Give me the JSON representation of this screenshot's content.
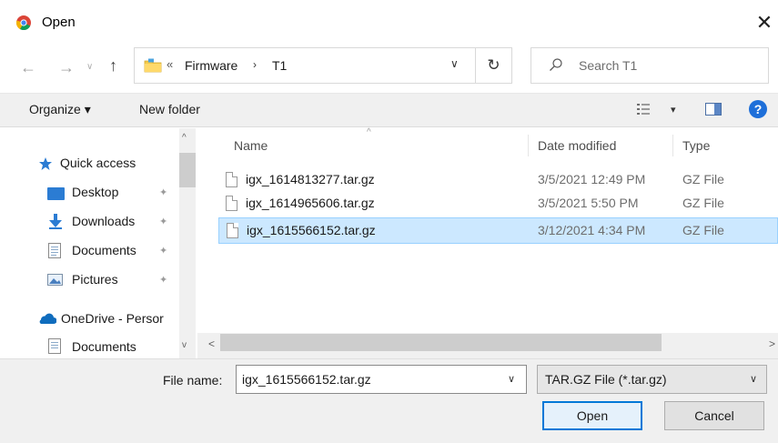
{
  "window": {
    "title": "Open",
    "close_glyph": "✕"
  },
  "nav": {
    "back_glyph": "←",
    "forward_glyph": "→",
    "recent_glyph": "∨",
    "up_glyph": "↑",
    "breadcrumb_overflow": "«",
    "breadcrumbs": [
      "Firmware",
      "T1"
    ],
    "breadcrumb_sep": "›",
    "address_dropdown": "∨",
    "refresh_glyph": "↻",
    "search_placeholder": "Search T1"
  },
  "toolbar": {
    "organize_label": "Organize ▾",
    "new_folder_label": "New folder",
    "view_dropdown": "▾",
    "help_glyph": "?"
  },
  "nav_pane": {
    "items": [
      {
        "label": "Quick access",
        "icon": "star-icon",
        "pinned": false
      },
      {
        "label": "Desktop",
        "icon": "desktop-folder-icon",
        "pinned": true
      },
      {
        "label": "Downloads",
        "icon": "download-arrow-icon",
        "pinned": true
      },
      {
        "label": "Documents",
        "icon": "documents-icon",
        "pinned": true
      },
      {
        "label": "Pictures",
        "icon": "pictures-icon",
        "pinned": true
      },
      {
        "label": "OneDrive - Persor",
        "icon": "cloud-icon",
        "pinned": false
      },
      {
        "label": "Documents",
        "icon": "documents-icon",
        "pinned": false
      }
    ],
    "pin_glyph": "📌",
    "scroll_up": "^",
    "scroll_down": "v"
  },
  "file_list": {
    "sort_caret": "^",
    "columns": [
      "Name",
      "Date modified",
      "Type"
    ],
    "rows": [
      {
        "name": "igx_1614813277.tar.gz",
        "date": "3/5/2021 12:49 PM",
        "type": "GZ File",
        "selected": false
      },
      {
        "name": "igx_1614965606.tar.gz",
        "date": "3/5/2021 5:50 PM",
        "type": "GZ File",
        "selected": false
      },
      {
        "name": "igx_1615566152.tar.gz",
        "date": "3/12/2021 4:34 PM",
        "type": "GZ File",
        "selected": true
      }
    ],
    "hscroll_left": "<",
    "hscroll_right": ">"
  },
  "footer": {
    "file_name_label": "File name:",
    "file_name_value": "igx_1615566152.tar.gz",
    "file_name_dropdown": "∨",
    "filter_value": "TAR.GZ File (*.tar.gz)",
    "filter_dropdown": "∨",
    "open_label": "Open",
    "cancel_label": "Cancel"
  },
  "colors": {
    "selection_bg": "#cce8ff",
    "selection_border": "#99d1ff",
    "accent": "#0078d7",
    "help_blue": "#1e6fd9"
  }
}
